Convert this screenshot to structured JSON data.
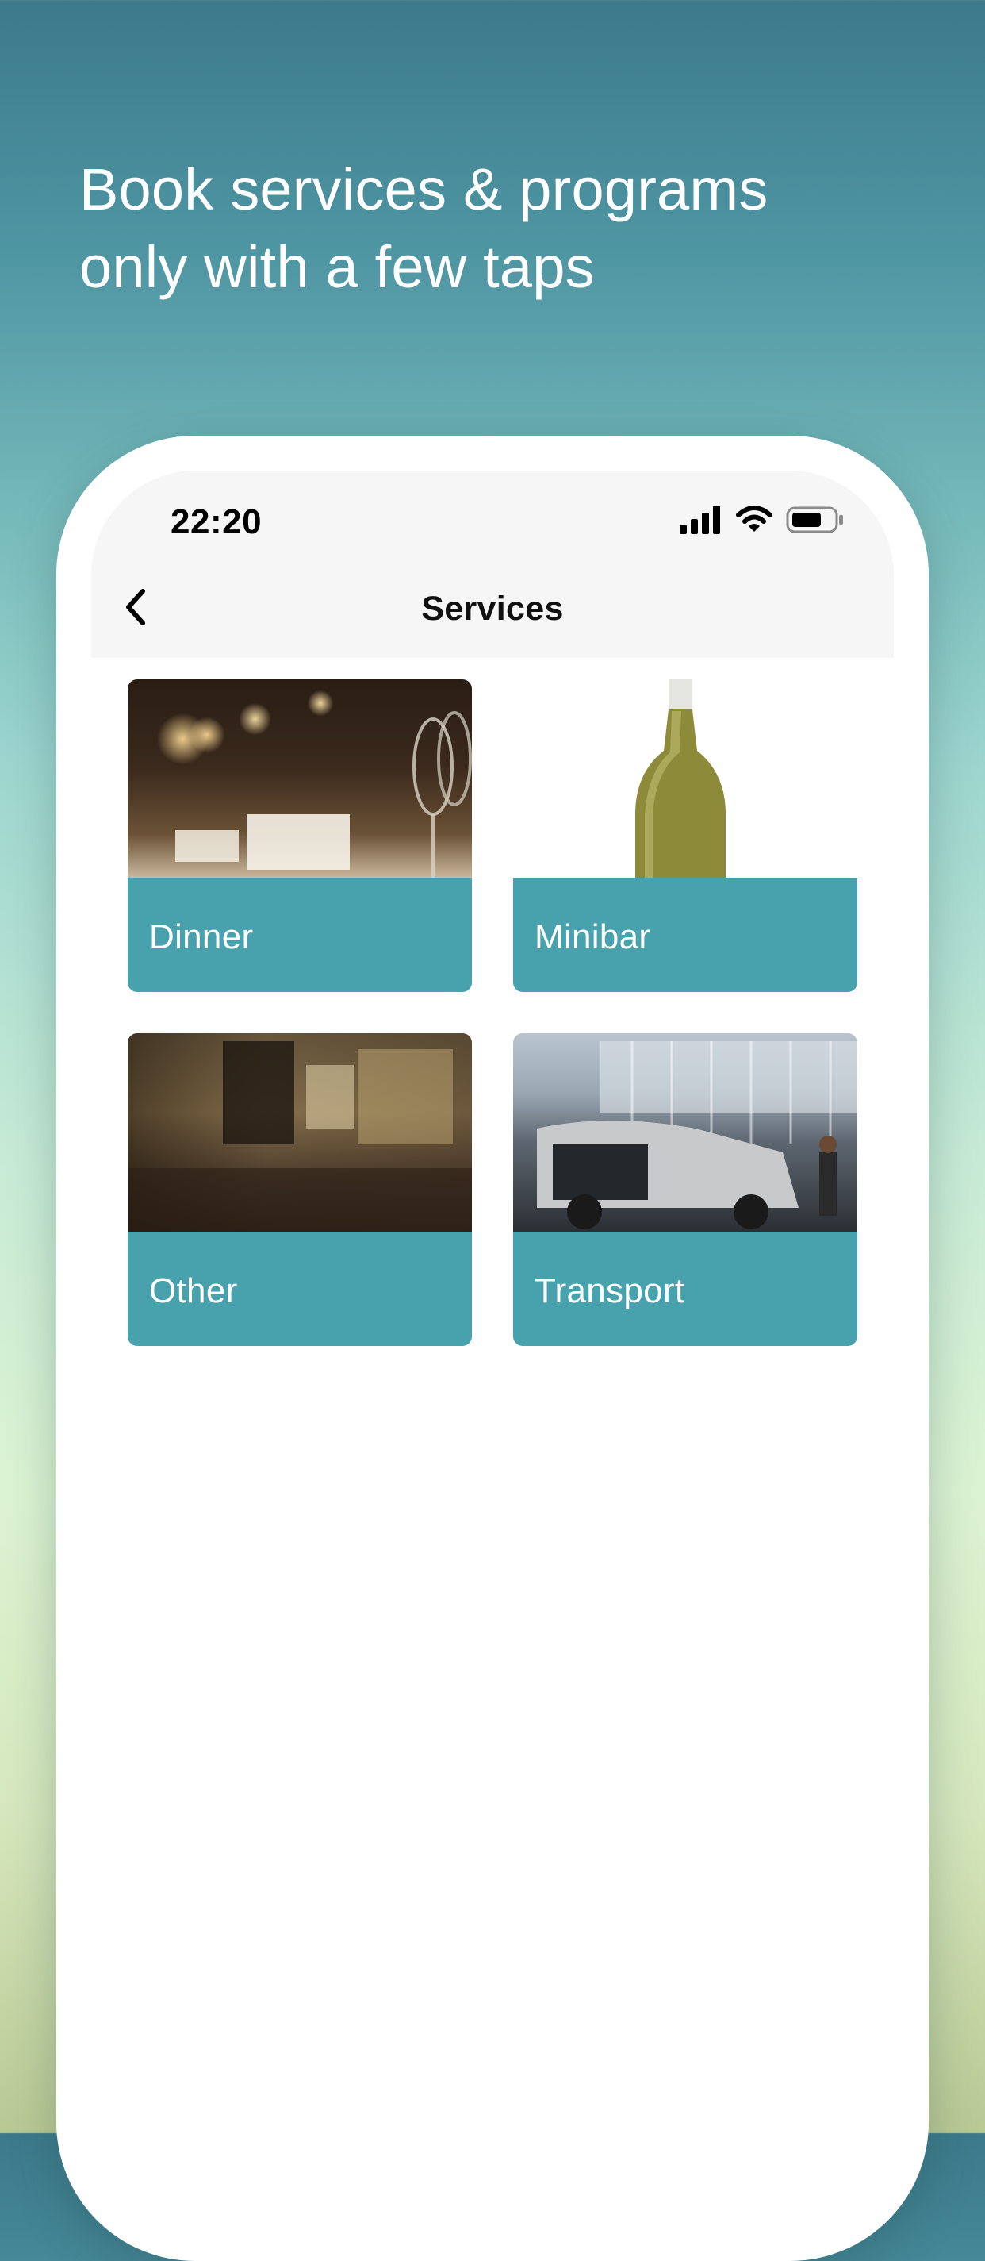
{
  "headline": {
    "line1": "Book services & programs",
    "line2": "only with a few taps"
  },
  "status_bar": {
    "time": "22:20",
    "icons": [
      "cellular-signal-icon",
      "wifi-icon",
      "battery-icon"
    ]
  },
  "nav": {
    "title": "Services",
    "back_icon": "chevron-left-icon"
  },
  "services": [
    {
      "label": "Dinner",
      "photo": "restaurant-table-candles"
    },
    {
      "label": "Minibar",
      "photo": "white-wine-bottle"
    },
    {
      "label": "Other",
      "photo": "hotel-lounge-interior"
    },
    {
      "label": "Transport",
      "photo": "airport-van-transfer"
    }
  ],
  "colors": {
    "tile_band": "#409eaa",
    "headline_text": "#ffffff",
    "nav_background": "#f6f6f6"
  }
}
